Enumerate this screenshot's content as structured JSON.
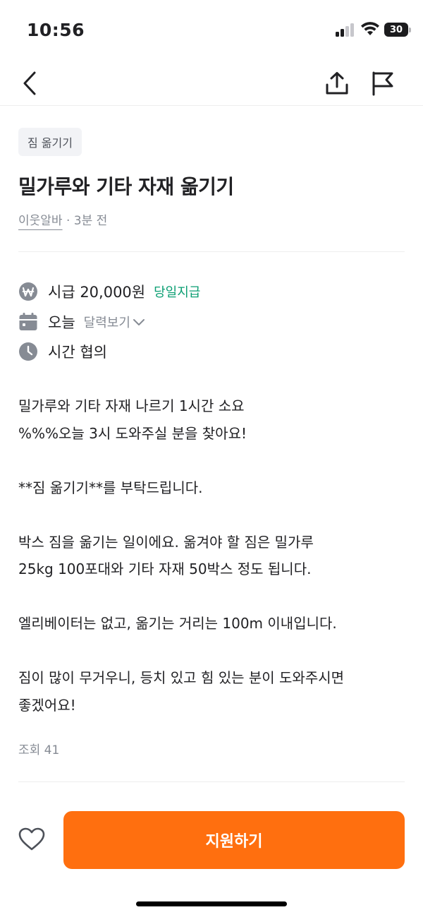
{
  "status_bar": {
    "time": "10:56",
    "battery_level": "30"
  },
  "nav": {
    "back_icon": "chevron-left-icon",
    "share_icon": "share-icon",
    "report_icon": "flag-icon"
  },
  "post": {
    "category": "짐 옮기기",
    "title": "밀가루와 기타 자재 옮기기",
    "author": "이웃알바",
    "time_ago": " · 3분 전"
  },
  "info": {
    "wage": "시급 20,000원",
    "pay_type": "당일지급",
    "date": "오늘",
    "calendar_link": "달력보기",
    "time": "시간 협의"
  },
  "description": "밀가루와 기타 자재 나르기 1시간 소요\n%%%오늘 3시 도와주실 분을 찾아요!\n\n**짐 옮기기**를 부탁드립니다.\n\n박스 짐을 옮기는 일이에요. 옮겨야 할 짐은 밀가루\n25kg 100포대와 기타 자재 50박스 정도 됩니다.\n\n엘리베이터는 없고, 옮기는 거리는 100m 이내입니다.\n\n짐이 많이 무거우니, 등치 있고 힘 있는 분이 도와주시면\n좋겠어요!",
  "stats": {
    "views": "조회 41"
  },
  "bottom": {
    "apply_label": "지원하기",
    "like_icon": "heart-icon"
  },
  "colors": {
    "accent": "#ff6f0f",
    "pay_badge": "#0a9e72",
    "secondary_text": "#868b94",
    "icon_gray": "#868b94"
  }
}
